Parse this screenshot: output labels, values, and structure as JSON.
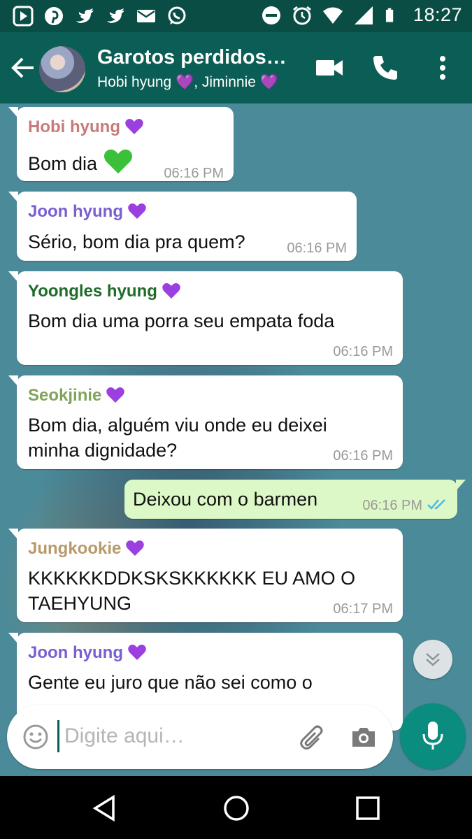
{
  "status_bar": {
    "time": "18:27",
    "left_icons": [
      "play-store-icon",
      "pinterest-icon",
      "twitter-icon",
      "twitter-icon",
      "mail-icon",
      "whatsapp-icon"
    ],
    "right_icons": [
      "do-not-disturb-icon",
      "alarm-icon",
      "wifi-icon",
      "signal-icon",
      "battery-icon"
    ]
  },
  "header": {
    "title": "Garotos perdidos…",
    "subtitle": "Hobi hyung 💜, Jiminnie 💜",
    "icons": [
      "back-arrow-icon",
      "group-avatar",
      "video-call-icon",
      "phone-icon",
      "more-vert-icon"
    ]
  },
  "colors": {
    "header": "#0b5e55",
    "status_bar": "#0a4d45",
    "incoming_bubble": "#ffffff",
    "outgoing_bubble": "#dcf8c6",
    "wallpaper": "#4b8a99",
    "read_ticks": "#4fb6ec",
    "heart": "#9b3fe0",
    "green_heart": "#3cc03a",
    "sender_hobi": "#c97a7a",
    "sender_joon": "#7a5fd1",
    "sender_yoongles": "#1f6b2a",
    "sender_seokjinie": "#7ea55a",
    "sender_jungkookie": "#b89a6a"
  },
  "messages": [
    {
      "sender": "Hobi hyung",
      "text": "Bom dia",
      "time": "06:16 PM"
    },
    {
      "sender": "Joon hyung",
      "text": "Sério, bom dia pra quem?",
      "time": "06:16 PM"
    },
    {
      "sender": "Yoongles hyung",
      "text": "Bom dia uma porra seu empata foda",
      "time": "06:16 PM"
    },
    {
      "sender": "Seokjinie",
      "line1": "Bom dia, alguém viu onde eu deixei",
      "line2": "minha dignidade?",
      "time": "06:16 PM"
    },
    {
      "outgoing": true,
      "text": "Deixou com o barmen",
      "time": "06:16 PM",
      "status": "read"
    },
    {
      "sender": "Jungkookie",
      "line1": "KKKKKKDDKSKSKKKKKK EU AMO O",
      "line2": "TAEHYUNG",
      "time": "06:17 PM"
    },
    {
      "sender": "Joon hyung",
      "text": "Gente eu juro que não sei como o"
    }
  ],
  "composer": {
    "placeholder": "Digite aqui…",
    "icons": [
      "emoji-icon",
      "attach-icon",
      "camera-icon",
      "mic-icon"
    ]
  },
  "nav_bar": {
    "icons": [
      "back-triangle-icon",
      "home-circle-icon",
      "recents-square-icon"
    ]
  }
}
